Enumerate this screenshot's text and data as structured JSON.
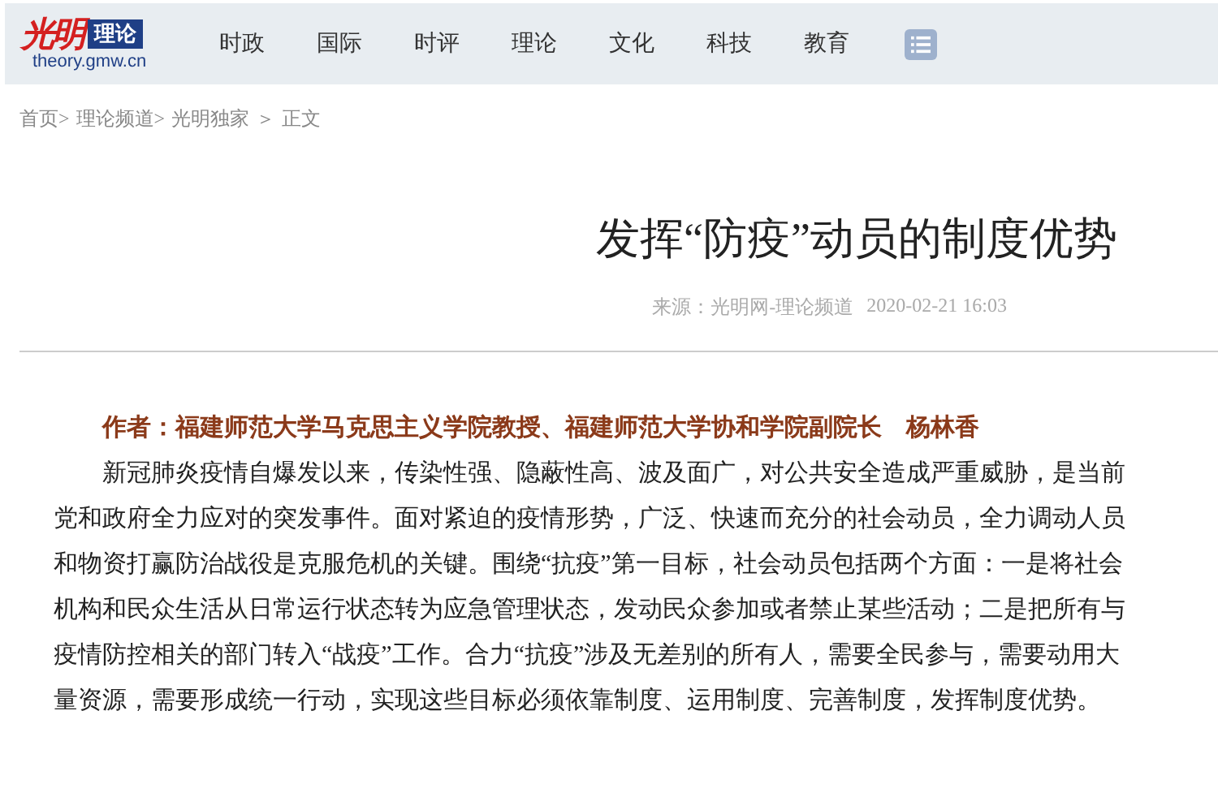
{
  "header": {
    "logo_mark": "光明",
    "logo_badge": "理论",
    "logo_domain": "theory.gmw.cn",
    "nav": [
      {
        "label": "时政"
      },
      {
        "label": "国际"
      },
      {
        "label": "时评"
      },
      {
        "label": "理论"
      },
      {
        "label": "文化"
      },
      {
        "label": "科技"
      },
      {
        "label": "教育"
      }
    ]
  },
  "breadcrumb": [
    "首页>",
    "理论频道>",
    "光明独家",
    "＞",
    "正文"
  ],
  "article": {
    "title": "发挥“防疫”动员的制度优势",
    "source": "来源：光明网-理论频道",
    "date": "2020-02-21 16:03",
    "author": "作者：福建师范大学马克思主义学院教授、福建师范大学协和学院副院长　杨林香",
    "paragraphs": [
      "新冠肺炎疫情自爆发以来，传染性强、隐蔽性高、波及面广，对公共安全造成严重威胁，是当前党和政府全力应对的突发事件。面对紧迫的疫情形势，广泛、快速而充分的社会动员，全力调动人员和物资打赢防治战役是克服危机的关键。围绕“抗疫”第一目标，社会动员包括两个方面：一是将社会机构和民众生活从日常运行状态转为应急管理状态，发动民众参加或者禁止某些活动；二是把所有与疫情防控相关的部门转入“战疫”工作。合力“抗疫”涉及无差别的所有人，需要全民参与，需要动用大量资源，需要形成统一行动，实现这些目标必须依靠制度、运用制度、完善制度，发挥制度优势。"
    ]
  }
}
